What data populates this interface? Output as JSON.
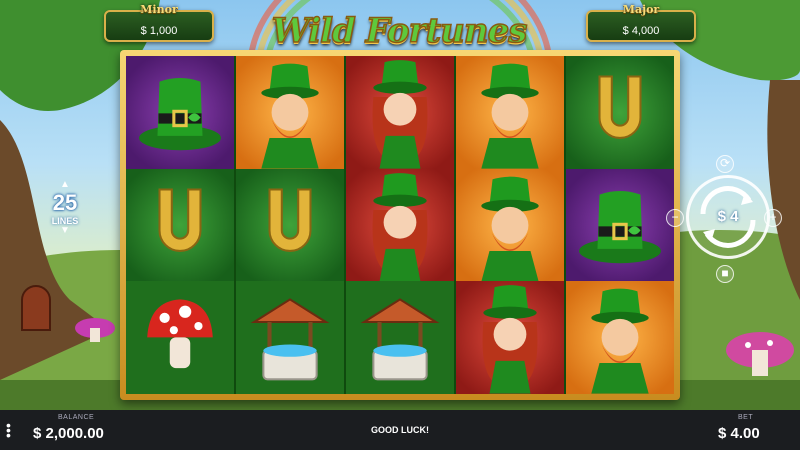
{
  "game": {
    "logo_text": "Wild Fortunes"
  },
  "jackpots": {
    "minor": {
      "title": "Minor",
      "value": "$ 1,000"
    },
    "major": {
      "title": "Major",
      "value": "$ 4,000"
    }
  },
  "lines": {
    "count": "25",
    "label": "LINES"
  },
  "spin": {
    "bet_amount": "$ 4"
  },
  "reels": [
    [
      "purple-hat",
      "green-horseshoe",
      "mushroom"
    ],
    [
      "orange-leprechaun",
      "green-horseshoe",
      "wishing-well"
    ],
    [
      "red-lady-tall",
      "red-lady",
      "wishing-well"
    ],
    [
      "orange-leprechaun",
      "orange-leprechaun",
      "red-lady"
    ],
    [
      "green-horseshoe",
      "purple-hat",
      "orange-leprechaun"
    ]
  ],
  "bottom_bar": {
    "balance_label": "BALANCE",
    "balance_value": "$ 2,000.00",
    "message": "GOOD LUCK!",
    "bet_label": "BET",
    "bet_value": "$ 4.00"
  },
  "colors": {
    "reel_bg": "#1e6b1c",
    "frame_gold": "#d9b04a",
    "bar_bg": "#1b1d20"
  }
}
